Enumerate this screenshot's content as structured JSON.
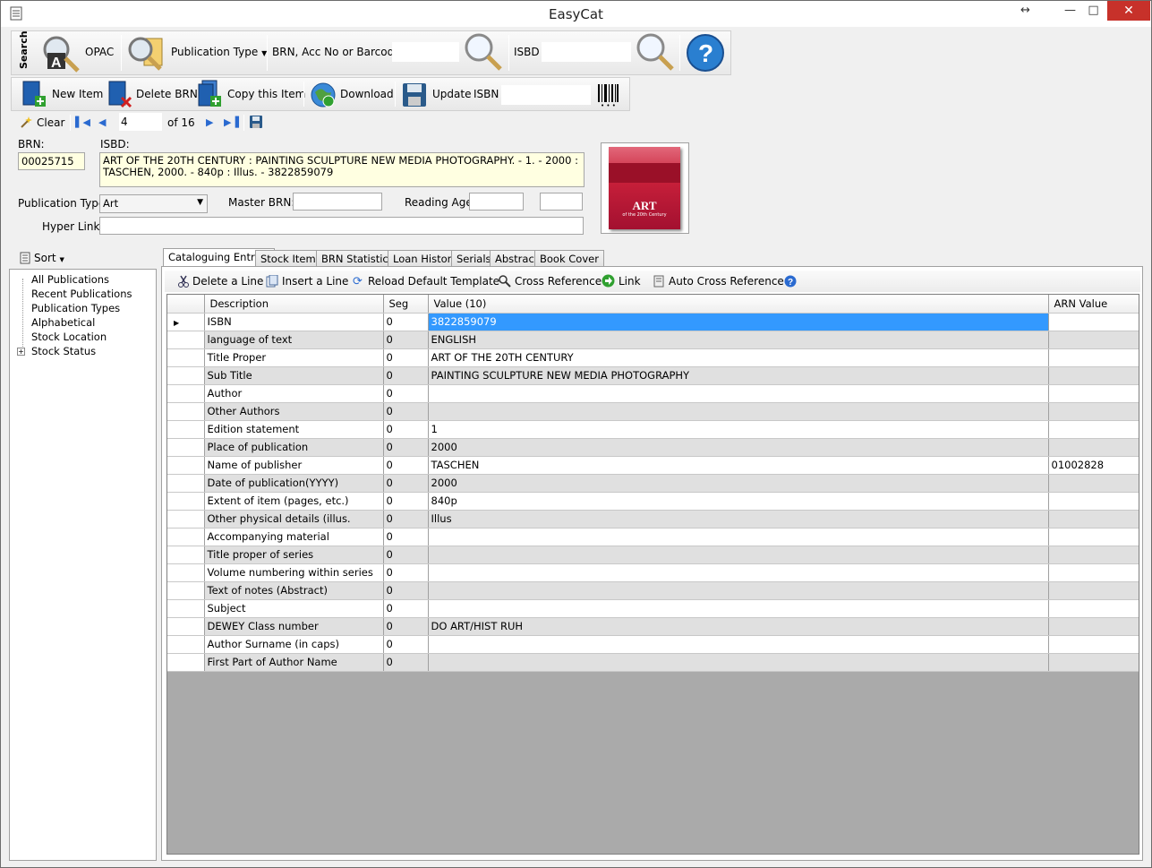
{
  "window": {
    "title": "EasyCat",
    "restore_glyph": "↔",
    "min_glyph": "—",
    "max_glyph": "□",
    "close_glyph": "✕"
  },
  "search_toolbar": {
    "side_label": "Search",
    "opac_label": "OPAC",
    "pubtype_label": "Publication Type",
    "brn_label": "BRN, Acc No or Barcode",
    "brn_value": "",
    "isbd_label": "ISBD",
    "isbd_value": ""
  },
  "item_toolbar": {
    "new_item": "New Item",
    "delete_brn": "Delete BRN",
    "copy_item": "Copy this Item",
    "download": "Download",
    "update": "Update",
    "isbn_label": "ISBN",
    "isbn_value": ""
  },
  "nav_toolbar": {
    "clear": "Clear",
    "current": "4",
    "of_total": "of 16"
  },
  "form": {
    "brn_label": "BRN:",
    "brn_value": "00025715",
    "isbd_label": "ISBD:",
    "isbd_value": "ART OF THE 20TH CENTURY : PAINTING SCULPTURE NEW MEDIA PHOTOGRAPHY. - 1. - 2000 : TASCHEN, 2000. - 840p : Illus. - 3822859079",
    "pubtype_label": "Publication Type",
    "pubtype_value": "Art",
    "master_brn_label": "Master BRN:",
    "master_brn_value": "",
    "reading_age_label": "Reading Age",
    "reading_age_from": "",
    "reading_age_to": "",
    "hyperlink_label": "Hyper Link:",
    "hyperlink_value": ""
  },
  "cover": {
    "title": "ART",
    "subtitle": "of the 20th Century"
  },
  "sidebar": {
    "sort_label": "Sort",
    "items": [
      "All Publications",
      "Recent Publications",
      "Publication Types",
      "Alphabetical",
      "Stock Location",
      "Stock Status"
    ]
  },
  "tabs": [
    "Cataloguing Entries",
    "Stock Items",
    "BRN Statistics",
    "Loan History",
    "Serials",
    "Abstract",
    "Book Cover"
  ],
  "grid_toolbar": {
    "delete_line": "Delete a Line",
    "insert_line": "Insert a Line",
    "reload_template": "Reload Default Template",
    "cross_reference": "Cross Reference",
    "link": "Link",
    "auto_cross_reference": "Auto Cross Reference"
  },
  "grid": {
    "columns": [
      "Description",
      "Seg",
      "Value (10)",
      "ARN Value"
    ],
    "rows": [
      [
        "ISBN",
        "0",
        "3822859079",
        ""
      ],
      [
        "language of text",
        "0",
        "ENGLISH",
        ""
      ],
      [
        "Title Proper",
        "0",
        "ART OF THE 20TH CENTURY",
        ""
      ],
      [
        "Sub Title",
        "0",
        "PAINTING SCULPTURE NEW MEDIA PHOTOGRAPHY",
        ""
      ],
      [
        "Author",
        "0",
        "",
        ""
      ],
      [
        "Other Authors",
        "0",
        "",
        ""
      ],
      [
        "Edition statement",
        "0",
        "1",
        ""
      ],
      [
        "Place of publication",
        "0",
        "2000",
        ""
      ],
      [
        "Name of publisher",
        "0",
        "TASCHEN",
        "01002828"
      ],
      [
        "Date of publication(YYYY)",
        "0",
        "2000",
        ""
      ],
      [
        "Extent of item (pages, etc.)",
        "0",
        "840p",
        ""
      ],
      [
        "Other physical details (illus.",
        "0",
        "Illus",
        ""
      ],
      [
        "Accompanying material",
        "0",
        "",
        ""
      ],
      [
        "Title proper of series",
        "0",
        "",
        ""
      ],
      [
        "Volume numbering within series",
        "0",
        "",
        ""
      ],
      [
        "Text of notes (Abstract)",
        "0",
        "",
        ""
      ],
      [
        "Subject",
        "0",
        "",
        ""
      ],
      [
        "DEWEY Class number",
        "0",
        "DO ART/HIST RUH",
        ""
      ],
      [
        "Author Surname (in caps)",
        "0",
        "",
        ""
      ],
      [
        "First Part of Author Name",
        "0",
        "",
        ""
      ]
    ]
  }
}
